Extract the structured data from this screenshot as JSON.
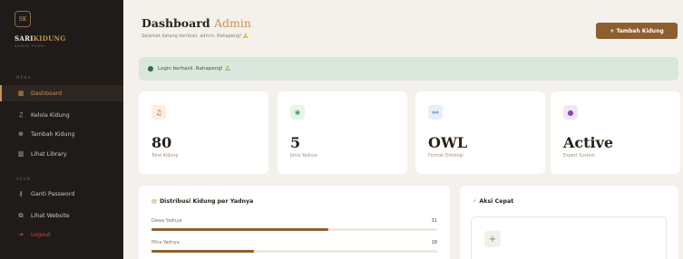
{
  "sidebar": {
    "logo_text": "SK",
    "brand_main": "SARI",
    "brand_accent": "KIDUNG",
    "brand_sub": "ADMIN PANEL",
    "section_menu": "MENU",
    "section_akun": "AKUN",
    "items": [
      {
        "label": "Dashboard",
        "icon": "grid-icon"
      },
      {
        "label": "Kelola Kidung",
        "icon": "music-icon"
      },
      {
        "label": "Tambah Kidung",
        "icon": "plus-circle-icon"
      },
      {
        "label": "Lihat Library",
        "icon": "library-icon"
      }
    ],
    "account_items": [
      {
        "label": "Ganti Password",
        "icon": "key-icon"
      },
      {
        "label": "Lihat Website",
        "icon": "external-link-icon"
      },
      {
        "label": "Logout",
        "icon": "logout-icon"
      }
    ]
  },
  "header": {
    "title": "Dashboard",
    "title_accent": "Admin",
    "subtitle": "Selamat datang kembali, admin, Rahapeng! 🙏",
    "add_button": "+ Tambah Kidung"
  },
  "alert": {
    "text": "Login berhasil. Rahapeng! 🙏"
  },
  "stats": [
    {
      "value": "80",
      "label": "Total Kidung",
      "icon": "music-icon",
      "icon_bg": "#fbeee0",
      "icon_color": "#a0612e"
    },
    {
      "value": "5",
      "label": "Jenis Yadnya",
      "icon": "lotus-icon",
      "icon_bg": "#e6f5ea",
      "icon_color": "#3c8a55"
    },
    {
      "value": "OWL",
      "label": "Format Ontologi",
      "icon": "hierarchy-icon",
      "icon_bg": "#e6eef9",
      "icon_color": "#3d6db5"
    },
    {
      "value": "Active",
      "label": "Expert System",
      "icon": "brain-icon",
      "icon_bg": "#f1e6f8",
      "icon_color": "#8a47b8"
    }
  ],
  "distribution": {
    "title": "Distribusi Kidung per Yadnya",
    "rows": [
      {
        "label": "Dewa Yadnya",
        "value": "31",
        "fraction": 0.62
      },
      {
        "label": "Pitra Yadnya",
        "value": "18",
        "fraction": 0.36
      }
    ]
  },
  "quick_actions": {
    "title": "Aksi Cepat",
    "plus": "+"
  }
}
